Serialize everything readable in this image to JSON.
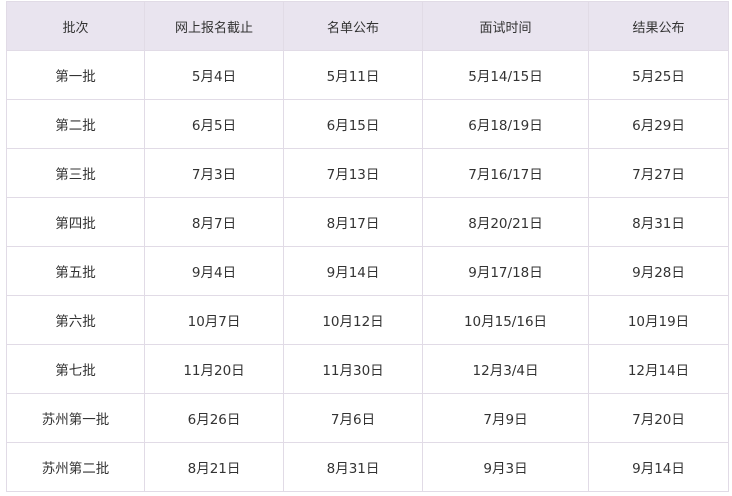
{
  "table": {
    "headers": [
      "批次",
      "网上报名截止",
      "名单公布",
      "面试时间",
      "结果公布"
    ],
    "rows": [
      [
        "第一批",
        "5月4日",
        "5月11日",
        "5月14/15日",
        "5月25日"
      ],
      [
        "第二批",
        "6月5日",
        "6月15日",
        "6月18/19日",
        "6月29日"
      ],
      [
        "第三批",
        "7月3日",
        "7月13日",
        "7月16/17日",
        "7月27日"
      ],
      [
        "第四批",
        "8月7日",
        "8月17日",
        "8月20/21日",
        "8月31日"
      ],
      [
        "第五批",
        "9月4日",
        "9月14日",
        "9月17/18日",
        "9月28日"
      ],
      [
        "第六批",
        "10月7日",
        "10月12日",
        "10月15/16日",
        "10月19日"
      ],
      [
        "第七批",
        "11月20日",
        "11月30日",
        "12月3/4日",
        "12月14日"
      ],
      [
        "苏州第一批",
        "6月26日",
        "7月6日",
        "7月9日",
        "7月20日"
      ],
      [
        "苏州第二批",
        "8月21日",
        "8月31日",
        "9月3日",
        "9月14日"
      ]
    ]
  },
  "colors": {
    "header_background": "#e9e4ef",
    "border": "#e1dbe6",
    "text": "#333333"
  }
}
